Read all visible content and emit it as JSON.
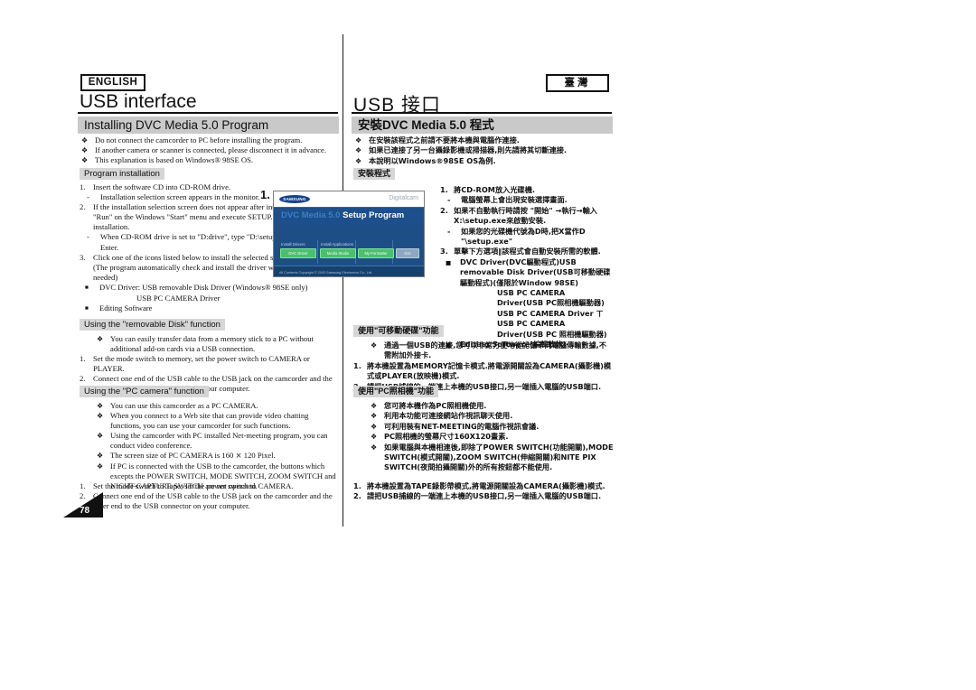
{
  "document": {
    "page_number": "78",
    "language_badges": {
      "english": "ENGLISH",
      "chinese": "臺灣"
    },
    "titles": {
      "english": "USB interface",
      "chinese": "USB 接口"
    },
    "section_banner": {
      "english": "Installing DVC Media 5.0 Program",
      "chinese": "安裝DVC Media 5.0 程式"
    }
  },
  "english": {
    "intro_bullets": [
      "Do not connect the camcorder to PC before installing the program.",
      "If another camera or scanner is connected, please disconnect it in advance.",
      "This explanation is based on Windows® 98SE OS."
    ],
    "program_installation": {
      "heading": "Program installation",
      "steps": [
        {
          "marker": "1.",
          "text": "Insert the software CD into CD-ROM drive."
        },
        {
          "marker": "-",
          "text": "Installation selection screen appears in the monitor."
        },
        {
          "marker": "2.",
          "text": "If the installation selection screen does not appear after inserting the CD click \"Run\" on the Windows \"Start\" menu and execute SETUP.EXE file to begin installation."
        },
        {
          "marker": "-",
          "text": "When CD-ROM drive is set to \"D:drive\", type \"D:\\setup.exe\" and press Enter."
        },
        {
          "marker": "3.",
          "text": "Click one of the icons listed below to install the selected software."
        },
        {
          "marker": "",
          "text": "(The program automatically check and install the driver which the PC is needed)"
        },
        {
          "marker": "■",
          "text": "DVC Driver: USB removable Disk Driver (Windows® 98SE only)"
        },
        {
          "marker": "",
          "text": "USB PC CAMERA Driver",
          "deep_indent": true
        },
        {
          "marker": "■",
          "text": "Editing Software"
        }
      ]
    },
    "removable_disk": {
      "heading": "Using the \"removable Disk\" function",
      "bullets": [
        "You can easily transfer data from a memory stick to a PC without additional add-on cards via a USB connection."
      ],
      "steps": [
        {
          "marker": "1.",
          "text": "Set the mode switch to memory, set the power switch to CAMERA or PLAYER."
        },
        {
          "marker": "2.",
          "text": "Connect one end of the USB cable to the USB jack on the camcorder and the other end to the USB connector on your computer."
        }
      ]
    },
    "pc_camera": {
      "heading": "Using the \"PC camera\" function",
      "bullets": [
        "You can use this camcorder as a PC CAMERA.",
        "When you connect to a Web site that can provide video chatting functions, you can use your camcorder for such functions.",
        "Using the camcorder with PC installed Net-meeting program, you can conduct video conference.",
        "The screen size of PC CAMERA is 160 ⨯ 120 Pixel.",
        "If PC is connected with the USB to the camcorder, the buttons which excepts the POWER SWITCH, MODE SWITCH, ZOOM SWITCH and NIGHT-CAPTURE SWITCH are not operated."
      ],
      "steps": [
        {
          "marker": "1.",
          "text": "Set the mode switch to Tape, set the power switch to CAMERA."
        },
        {
          "marker": "2.",
          "text": "Connect one end of the USB cable to the USB jack on the camcorder and the other end to the USB connector on your computer."
        }
      ]
    }
  },
  "chinese": {
    "intro_bullets": [
      "在安裝該程式之前請不要將本機與電腦作連接.",
      "如果已連接了另一台攝錄影機或掃描器,則先請將其切斷連接.",
      "本說明以Windows®98SE OS為例."
    ],
    "program_installation": {
      "heading": "安裝程式",
      "steps": [
        {
          "marker": "1.",
          "text": "將CD-ROM放入光碟機."
        },
        {
          "marker": "-",
          "text": "電腦螢幕上會出現安裝選擇畫面."
        },
        {
          "marker": "2.",
          "text": "如果不自動執行時請按 \"開始\" →執行→輸入 X:\\setup.exe來啟動安裝."
        },
        {
          "marker": "-",
          "text": "如果您的光碟機代號為D時,把X當作D \"\\setup.exe\""
        },
        {
          "marker": "3.",
          "text": "單擊下方選項‖該程式會自動安裝所需的軟體."
        },
        {
          "marker": "■",
          "text": "DVC Driver(DVC驅動程式)USB removable Disk Driver(USB可移動硬碟驅動程式)(僅限於Window 98SE)"
        },
        {
          "marker": "",
          "text": "USB PC CAMERA Driver(USB PC照相機驅動器)",
          "deep_indent": true
        },
        {
          "marker": "",
          "text": "USB PC CAMERA Driver ㄒUSB PC CAMERA Driver(USB PC 照相機驅動器)",
          "deep_indent": true
        },
        {
          "marker": "■",
          "text": "Editing Software(編輯軟体)"
        }
      ]
    },
    "removable_disk": {
      "heading": "使用\"可移動硬碟\"功能",
      "bullets": [
        "通過一個USB的連接,您可以非常方便地從記憶卡向電腦傳輸數據,不需附加外接卡."
      ],
      "steps": [
        {
          "marker": "1.",
          "text": "將本機設置為MEMORY記憶卡模式.將電源開關設為CAMERA(攝影機)模式或PLAYER(放映機)模式."
        },
        {
          "marker": "2.",
          "text": "請把USB捕線的一端連上本機的USB接口,另一端插入電腦的USB端口."
        }
      ]
    },
    "pc_camera": {
      "heading": "使用\"PC照相機\"功能",
      "bullets": [
        "您可將本機作為PC照相機使用.",
        "利用本功能可連接網站作視訊聊天使用.",
        "可利用裝有NET-MEETING的電腦作視訊會議.",
        "PC照相機的螢幕尺寸160X120畫素.",
        "如果電腦與本機相連後,即除了POWER SWITCH(功能開關),MODE SWITCH(模式開關),ZOOM SWITCH(伸縮開關)和NITE PIX SWITCH(夜間拍攝開關)外的所有按鈕都不能使用."
      ],
      "steps": [
        {
          "marker": "1.",
          "text": "將本機設置為TAPE錄影帶模式,將電源開關設為CAMERA(攝影機)模式."
        },
        {
          "marker": "2.",
          "text": "請把USB捕線的一端連上本機的USB接口,另一端插入電腦的USB端口."
        }
      ]
    }
  },
  "setup_screenshot": {
    "step_number": "1.",
    "brand_logo": "SAMSUNG",
    "product_label": "Digitalcam",
    "title_dim": "DVC Media 5.0",
    "title_lit": "Setup Program",
    "group_labels": [
      "Install Drivers",
      "Install Applications"
    ],
    "buttons": [
      "DVC Driver",
      "Media Studio",
      "My-Formatter",
      "Exit"
    ],
    "copyright": "All Contents Copyright © 2003 Samsung Electronics Co., Ltd."
  }
}
